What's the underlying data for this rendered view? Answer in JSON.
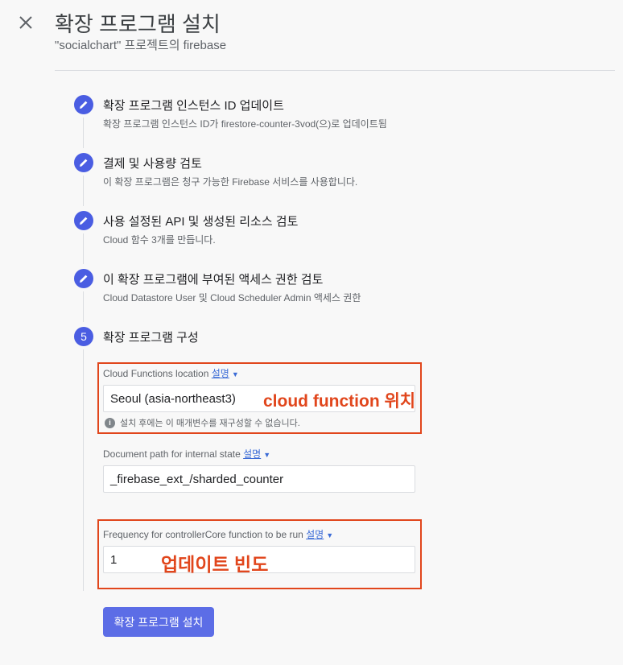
{
  "header": {
    "title": "확장 프로그램 설치",
    "subtitle": "\"socialchart\" 프로젝트의 firebase"
  },
  "steps": [
    {
      "title": "확장 프로그램 인스턴스 ID 업데이트",
      "subtitle": "확장 프로그램 인스턴스 ID가 firestore-counter-3vod(으)로 업데이트됨",
      "state": "edit"
    },
    {
      "title": "결제 및 사용량 검토",
      "subtitle": "이 확장 프로그램은 청구 가능한 Firebase 서비스를 사용합니다.",
      "state": "edit"
    },
    {
      "title": "사용 설정된 API 및 생성된 리소스 검토",
      "subtitle": "Cloud 함수 3개를 만듭니다.",
      "state": "edit"
    },
    {
      "title": "이 확장 프로그램에 부여된 액세스 권한 검토",
      "subtitle": "Cloud Datastore User 및 Cloud Scheduler Admin 액세스 권한",
      "state": "edit"
    },
    {
      "number": "5",
      "title": "확장 프로그램 구성",
      "state": "active"
    }
  ],
  "config": {
    "location": {
      "label": "Cloud Functions location",
      "help_link": "설명",
      "value": "Seoul (asia-northeast3)",
      "hint": "설치 후에는 이 매개변수를 재구성할 수 없습니다."
    },
    "document_path": {
      "label": "Document path for internal state",
      "help_link": "설명",
      "value": "_firebase_ext_/sharded_counter"
    },
    "frequency": {
      "label": "Frequency for controllerCore function to be run",
      "help_link": "설명",
      "value": "1"
    }
  },
  "annotations": {
    "location": "cloud function 위치",
    "frequency": "업데이트 빈도",
    "color": "#e1461c"
  },
  "install_button": "확장 프로그램 설치",
  "colors": {
    "accent": "#4a5de2",
    "button": "#5c6de6",
    "link": "#3b6bd6",
    "background": "#f8f8f8"
  },
  "icons": {
    "close": "close-icon",
    "step_done": "pencil-icon",
    "hint": "info-icon",
    "help_dropdown": "caret-down-icon"
  }
}
